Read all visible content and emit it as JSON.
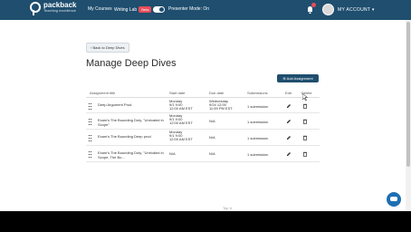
{
  "nav": {
    "logo_text": "packback",
    "logo_sub": "Teaching excellence",
    "my_courses": "My Courses",
    "writing_lab": "Writing Lab",
    "writing_lab_badge": "Beta",
    "presenter_mode": "Presenter Mode: On",
    "account": "MY ACCOUNT ▾"
  },
  "page": {
    "back_button": "‹ Back to Deep Dives",
    "title": "Manage Deep Dives",
    "add_button": "⊕ Add Assignment"
  },
  "table": {
    "headers": [
      "Assignment title",
      "Start date",
      "Due date",
      "Submissions",
      "Edit",
      "Delete"
    ],
    "rows": [
      {
        "title": "Deep Argument Prod",
        "start": "Monday\n9/1 9:00\n12:00 AM EST",
        "due": "Wednesday\n9/24 12:00\n11:59 PM EST",
        "submissions": "1 submission"
      },
      {
        "title": "Exam's The Bounding Duty, \"Unrivaled in\nScope\"",
        "start": "Monday\n9/1 9:00\n12:00 AM EST",
        "due": "N/A",
        "submissions": "1 submission"
      },
      {
        "title": "Exam's The Bounding Deep prod",
        "start": "Monday\n9/1 9:00\n12:00 AM EST",
        "due": "N/A",
        "submissions": "1 submission"
      },
      {
        "title": "Exam's The Bounding Duty, \"Unrivaled in\nScope, The Bo...",
        "start": "N/A",
        "due": "N/A",
        "submissions": "1 submission"
      }
    ]
  },
  "footer": {
    "label": "Top ∧"
  },
  "colors": {
    "nav_bg": "#1f4e6e",
    "accent": "#1f6fb2",
    "badge": "#e74c5a"
  }
}
